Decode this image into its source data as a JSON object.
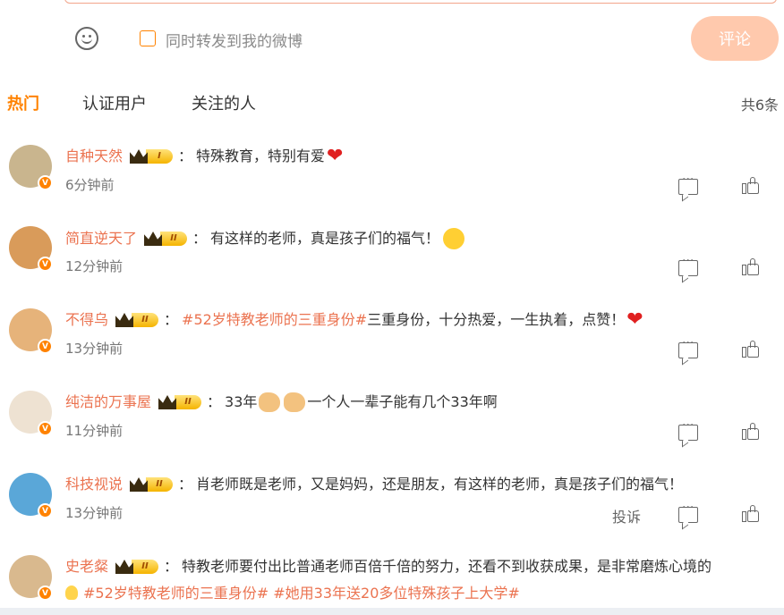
{
  "compose": {
    "forward_label": "同时转发到我的微博",
    "submit_label": "评论"
  },
  "tabs": [
    {
      "label": "热门",
      "active": true
    },
    {
      "label": "认证用户",
      "active": false
    },
    {
      "label": "关注的人",
      "active": false
    }
  ],
  "total_count": "共6条",
  "comments": [
    {
      "username": "自种天然",
      "level": "I",
      "text": "特殊教育，特别有爱",
      "emoji": "heart",
      "time": "6分钟前",
      "avatar_color": "#c9b58e"
    },
    {
      "username": "简直逆天了",
      "level": "II",
      "text": "有这样的老师，真是孩子们的福气！",
      "emoji": "666-face",
      "time": "12分钟前",
      "avatar_color": "#d99b5a"
    },
    {
      "username": "不得乌",
      "level": "II",
      "topic": "#52岁特教老师的三重身份#",
      "text": " 三重身份，十分热爱，一生执着，点赞！",
      "emoji": "heart",
      "time": "13分钟前",
      "avatar_color": "#e6b37a"
    },
    {
      "username": "纯洁的万事屋",
      "level": "II",
      "text_before": "33年",
      "text": "一个人一辈子能有几个33年啊",
      "emoji": "handshake-fist",
      "time": "11分钟前",
      "avatar_color": "#eee2d2"
    },
    {
      "username": "科技视说",
      "level": "II",
      "text": "肖老师既是老师，又是妈妈，还是朋友，有这样的老师，真是孩子们的福气！",
      "time": "13分钟前",
      "report_label": "投诉",
      "avatar_color": "#5aa7d8"
    },
    {
      "username": "史老粲",
      "level": "II",
      "text": "特教老师要付出比普通老师百倍千倍的努力，还看不到收获成果，是非常磨炼心境的",
      "topics_line2": "#52岁特教老师的三重身份# #她用33年送20多位特殊孩子上大学#",
      "emoji": "bulb",
      "avatar_color": "#d9b98e"
    }
  ],
  "badge_glyph": "V",
  "colon": "："
}
